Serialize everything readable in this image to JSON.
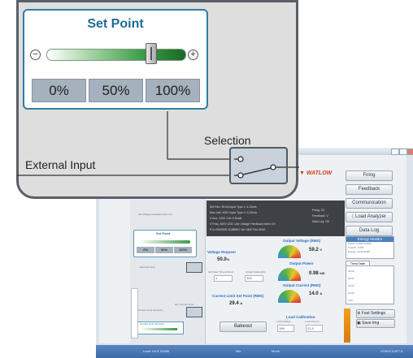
{
  "callout": {
    "set_point_title": "Set Point",
    "set_point_slider_value": 0.75,
    "preset_buttons": [
      "0%",
      "50%",
      "100%"
    ],
    "selection_label": "Selection",
    "external_input_label": "External Input"
  },
  "app": {
    "right_buttons": [
      "Firing",
      "Feedback",
      "Communication",
      "Load Analyzer",
      "Data Log"
    ],
    "logo_text": "WATLOW",
    "energy_monitor": {
      "title": "Energy Monitor",
      "lines": [
        "Power: 0.0WA   0.00W",
        "Cost/Hr: 0.000",
        "Energy: 10.90.0kWh"
      ]
    },
    "trend_tab": "Trend Table",
    "trend_values": [
      "40.00",
      "30.00",
      "20.00",
      "10.00",
      "0.00"
    ],
    "info_lines": [
      "Set Rev: 35.0A      Input Type 1: 4-20mA",
      "Max Volt: 400V      Input Type 2: 4-20mA",
      "V Aux: 120V         Ctrl: 0-Scale",
      "V Freq: 400V        LED: Use Voltage Feedback when On",
      "R to 0000005 11085847 Ver 0400 Rev 5000"
    ],
    "info_right": [
      "Firing: ZC",
      "Feedback: V",
      "Data Log: Off"
    ],
    "voltage_request": {
      "label": "Voltage Request",
      "value": "50.0",
      "unit": "%"
    },
    "soft_start_label": "Soft Start Time(x10sec)",
    "output_scaling_label": "Output Scaling(%)",
    "soft_start_value": "1",
    "output_scaling_value": "100",
    "current_limit_sp": {
      "label": "Current Limit Set Point (RMS)",
      "value": "29.4",
      "unit": "A"
    },
    "bakeout_button": "Bakeout",
    "output_voltage": {
      "label": "Output Voltage (RMS)",
      "value": "59.2",
      "unit": "V"
    },
    "output_power": {
      "label": "Output Power",
      "value": "0.98",
      "unit": "kW"
    },
    "output_current": {
      "label": "Output Current (RMS)",
      "value": "14.0",
      "unit": "A"
    },
    "load_calibration": {
      "label": "Load Calibration",
      "load_voltage_label": "Load Voltage",
      "load_current_label": "Load Current",
      "load_voltage": "199",
      "load_current": "21.4"
    },
    "fast_settings_button": "Fast Settings",
    "save_img_button": "Save Img",
    "diagram_labels": [
      "Set Voltage Feedback when On",
      "Set Point",
      "External Input",
      "Ext. Current Limit",
      "Current Limit Set Point"
    ],
    "mini_presets": [
      "0%",
      "50%",
      "100%"
    ],
    "status_bar": [
      "Load: 0x01 03488",
      "Idle",
      "Mode",
      "V/1503 3.0F7 A"
    ]
  },
  "colors": {
    "accent_blue": "#1f6b93",
    "slider_green": "#3b9b46",
    "logo_red": "#d23a1e",
    "status_bar": "#3c6aa8"
  }
}
